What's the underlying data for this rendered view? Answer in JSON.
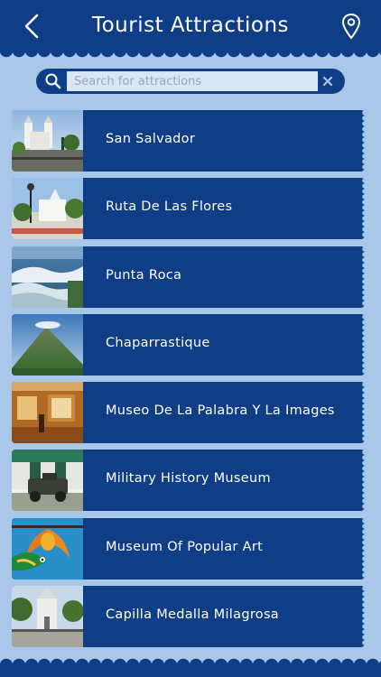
{
  "header": {
    "title": "Tourist Attractions",
    "back_icon": "chevron-left-icon",
    "location_icon": "map-pin-icon"
  },
  "search": {
    "placeholder": "Search for attractions",
    "value": "",
    "search_icon": "search-icon",
    "clear_icon": "close-icon"
  },
  "attractions": [
    {
      "label": "San Salvador",
      "thumb": "cathedral-photo"
    },
    {
      "label": "Ruta De Las Flores",
      "thumb": "plaza-photo"
    },
    {
      "label": "Punta Roca",
      "thumb": "waves-photo"
    },
    {
      "label": "Chaparrastique",
      "thumb": "volcano-photo"
    },
    {
      "label": "Museo De La Palabra Y La Images",
      "thumb": "museum-interior-photo"
    },
    {
      "label": "Military History Museum",
      "thumb": "military-museum-photo"
    },
    {
      "label": "Museum Of Popular Art",
      "thumb": "macaw-photo"
    },
    {
      "label": "Capilla Medalla Milagrosa",
      "thumb": "chapel-photo"
    }
  ],
  "colors": {
    "primary": "#0f3d86",
    "background": "#a9c8e9",
    "search_field": "#d8e6f5"
  }
}
